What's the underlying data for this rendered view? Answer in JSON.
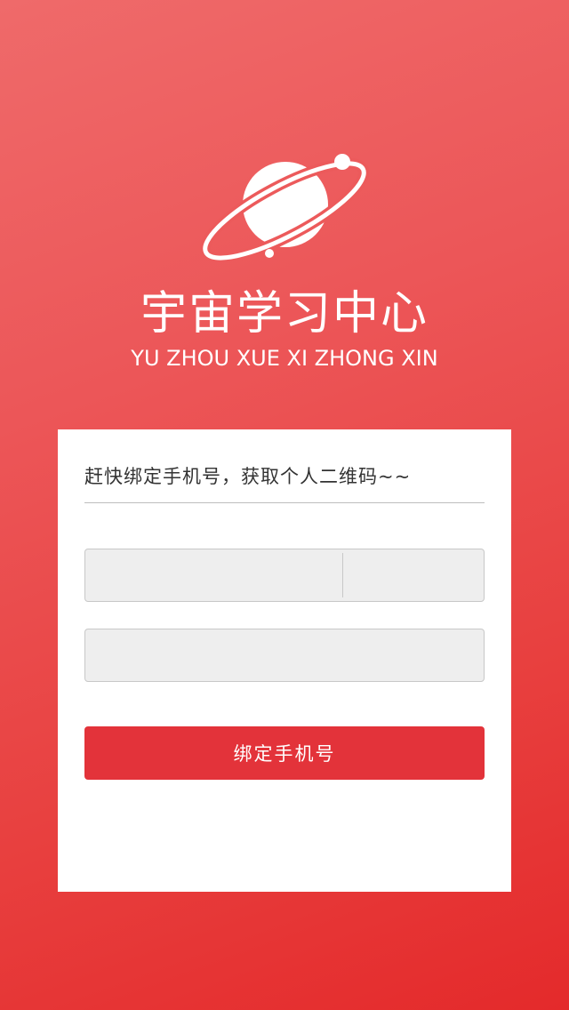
{
  "logo": {
    "icon": "planet-icon",
    "title": "宇宙学习中心",
    "subtitle": "YU ZHOU XUE XI ZHONG XIN"
  },
  "bind_form": {
    "heading": "赶快绑定手机号，获取个人二维码~~",
    "phone_input": {
      "value": "",
      "placeholder": ""
    },
    "code_button_label": "",
    "code_input": {
      "value": "",
      "placeholder": ""
    },
    "submit_label": "绑定手机号"
  },
  "colors": {
    "background_start": "#ef6a6a",
    "background_end": "#e42a2b",
    "button": "#e3333a",
    "card": "#ffffff",
    "field_bg": "#eeeeee"
  }
}
